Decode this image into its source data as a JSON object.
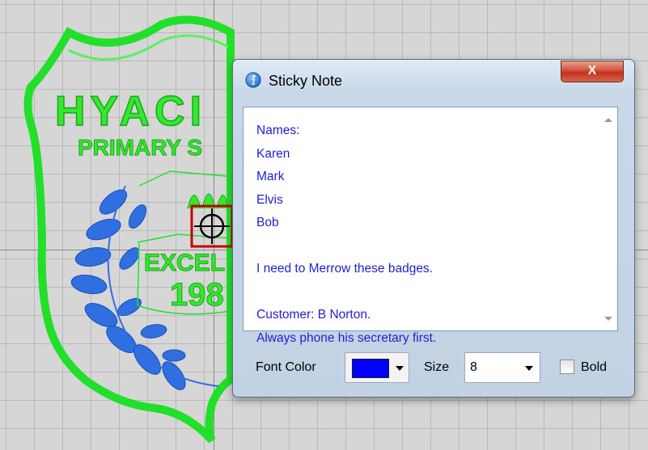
{
  "window": {
    "title": "Sticky Note",
    "close_label": "X"
  },
  "note": {
    "text": "Names:\nKaren\nMark\nElvis\nBob\n\nI need to Merrow these badges.\n\nCustomer: B Norton.\nAlways phone his secretary first.",
    "text_color": "#1f1fd6"
  },
  "controls": {
    "font_color_label": "Font Color",
    "font_color_value": "#0000ff",
    "size_label": "Size",
    "size_value": "8",
    "bold_label": "Bold",
    "bold_checked": false
  },
  "design": {
    "line1": "HYACI",
    "line2": "PRIMARY S",
    "line3": "EXCEL",
    "line4": "198",
    "outline_color": "#22e02a",
    "leaf_color": "#2f6fe0"
  }
}
